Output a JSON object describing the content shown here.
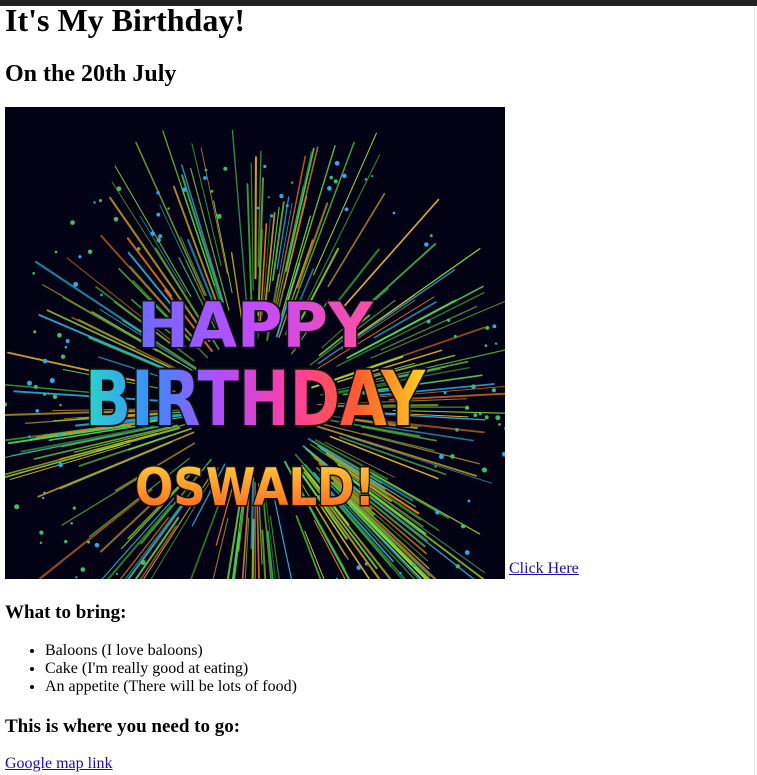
{
  "page": {
    "title": "It's My Birthday!",
    "subtitle": "On the 20th July"
  },
  "hero": {
    "graphic_name": "happy-birthday-fireworks-graphic",
    "line1": "HAPPY",
    "line2": "BIRTHDAY",
    "line3": "OSWALD!",
    "link_label": "Click Here"
  },
  "bring": {
    "heading": "What to bring:",
    "items": [
      "Baloons (I love baloons)",
      "Cake (I'm really good at eating)",
      "An appetite (There will be lots of food)"
    ]
  },
  "location": {
    "heading": "This is where you need to go:",
    "link_label": "Google map link"
  },
  "colors": {
    "link": "#1a0dab",
    "graphic_background": "#020214"
  }
}
